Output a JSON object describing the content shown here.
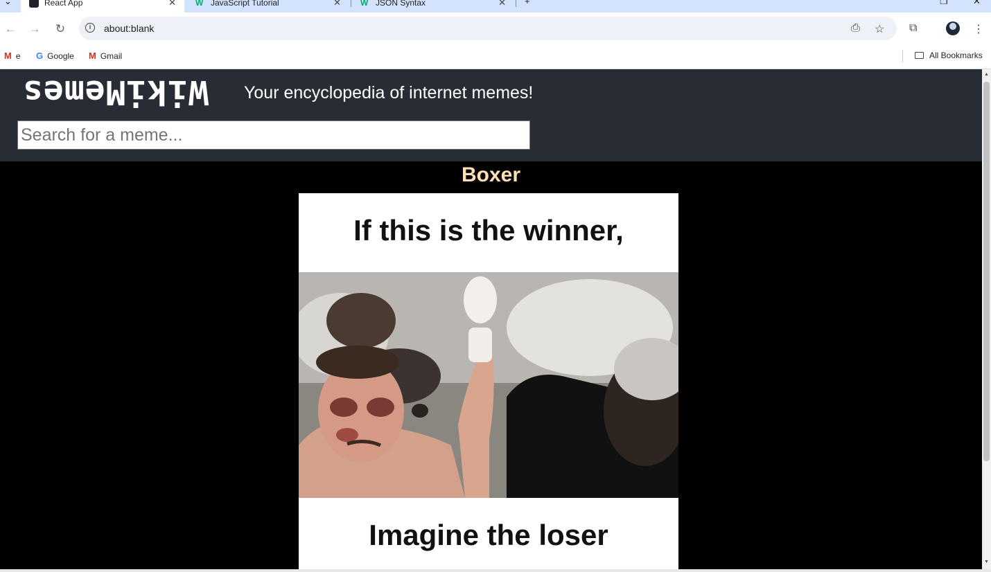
{
  "tabs": [
    {
      "title": "React App"
    },
    {
      "title": "JavaScript Tutorial"
    },
    {
      "title": "JSON Syntax"
    }
  ],
  "toolbar": {
    "url": "about:blank"
  },
  "bookmarks": {
    "items": [
      {
        "label": "e"
      },
      {
        "label": "Google"
      },
      {
        "label": "Gmail"
      }
    ],
    "all_bookmarks": "All Bookmarks"
  },
  "header": {
    "logo": "WikiMemes",
    "tagline": "Your encyclopedia of internet memes!",
    "search_placeholder": "Search for a meme..."
  },
  "meme": {
    "title": "Boxer",
    "caption_top": "If this is the winner,",
    "caption_bottom": "Imagine the loser"
  },
  "colors": {
    "header_bg": "#282c34",
    "meme_title": "#fde1b4",
    "tabstrip": "#d3e3fd"
  }
}
